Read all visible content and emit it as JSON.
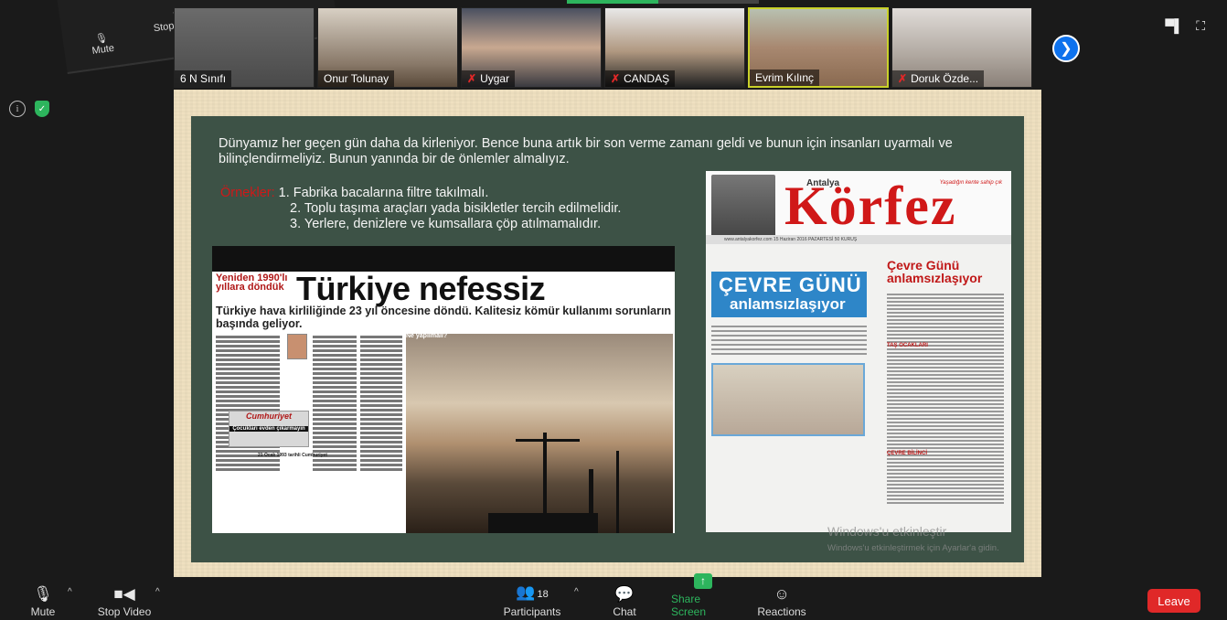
{
  "floating": {
    "mute_label": "Mute",
    "stop_video_label": "Stop Video"
  },
  "participants_strip": [
    {
      "name": "6 N Sınıfı",
      "muted": false
    },
    {
      "name": "Onur Tolunay",
      "muted": false
    },
    {
      "name": "Uygar",
      "muted": true
    },
    {
      "name": "CANDAŞ",
      "muted": true
    },
    {
      "name": "Evrim Kılınç",
      "muted": false
    },
    {
      "name": "Doruk Özde...",
      "muted": true
    }
  ],
  "slide": {
    "paragraph": "Dünyamız her geçen gün daha da kirleniyor. Bence buna artık bir son verme zamanı geldi ve bunun için insanları uyarmalı ve bilinçlendirmeliyiz.  Bunun yanında bir de önlemler almalıyız.",
    "examples_label": "Örnekler:",
    "examples": [
      "1. Fabrika bacalarına filtre takılmalı.",
      "2. Toplu taşıma araçları yada bisikletler tercih edilmelidir.",
      "3. Yerlere, denizlere ve kumsallara çöp atılmamalıdır."
    ]
  },
  "newspaper1": {
    "kicker": "Yeniden 1990'lı yıllara döndük",
    "headline": "Türkiye nefessiz",
    "subheadline": "Türkiye hava kirliliğinde 23 yıl öncesine döndü. Kalitesiz kömür kullanımı sorunların başında geliyor.",
    "box_title": "Cumhuriyet",
    "box_subtitle": "Çocukları evden çıkarmayın",
    "caption": "21 Ocak 1993 tarihli Cumhuriyet",
    "sidebar_title": "Ne yapılmalı?"
  },
  "newspaper2": {
    "city": "Antalya",
    "masthead": "Körfez",
    "slogan": "Yaşadığın kente sahip çık",
    "date_bar": "www.antalyakorfez.com   15 Haziran 2016 PAZARTESİ   50 KURUŞ",
    "feature_title_1": "ÇEVRE GÜNÜ",
    "feature_title_2": "anlamsızlaşıyor",
    "right_title": "Çevre Günü anlamsızlaşıyor",
    "section_1": "TAŞ OCAKLARI",
    "section_2": "ÇEVRE BİLİNCİ"
  },
  "watermark": {
    "line1": "Windows'u etkinleştir",
    "line2": "Windows'u etkinleştirmek için Ayarlar'a gidin."
  },
  "toolbar": {
    "mute_label": "Mute",
    "stop_video_label": "Stop Video",
    "participants_label": "Participants",
    "participants_count": "18",
    "chat_label": "Chat",
    "share_label": "Share Screen",
    "reactions_label": "Reactions",
    "leave_label": "Leave"
  },
  "colors": {
    "accent_blue": "#0e72ed",
    "share_green": "#2db55d",
    "leave_red": "#e02828",
    "slide_bg": "#3d5246"
  }
}
